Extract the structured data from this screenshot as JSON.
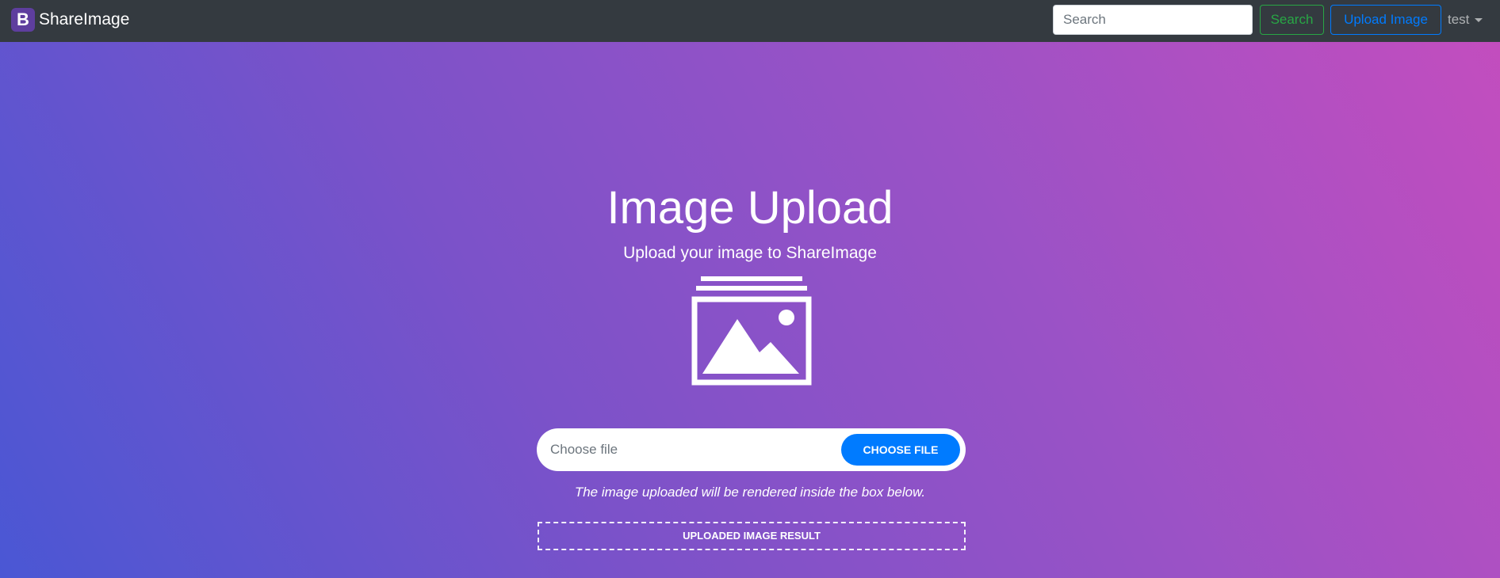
{
  "navbar": {
    "brand_letter": "B",
    "brand_name": "ShareImage",
    "search_placeholder": "Search",
    "search_button": "Search",
    "upload_button": "Upload Image",
    "user_label": "test"
  },
  "main": {
    "title": "Image Upload",
    "subtitle": "Upload your image to ShareImage",
    "icon": "image-icon",
    "file_placeholder": "Choose file",
    "choose_button": "CHOOSE FILE",
    "note": "The image uploaded will be rendered inside the box below.",
    "result_label": "UPLOADED IMAGE RESULT"
  },
  "colors": {
    "navbar_bg": "#343a40",
    "brand_logo_bg": "#5e3e9e",
    "search_button": "#28a745",
    "upload_button": "#007bff",
    "choose_button_bg": "#007bff",
    "gradient_start": "#4a57d4",
    "gradient_end": "#c44dbe"
  }
}
